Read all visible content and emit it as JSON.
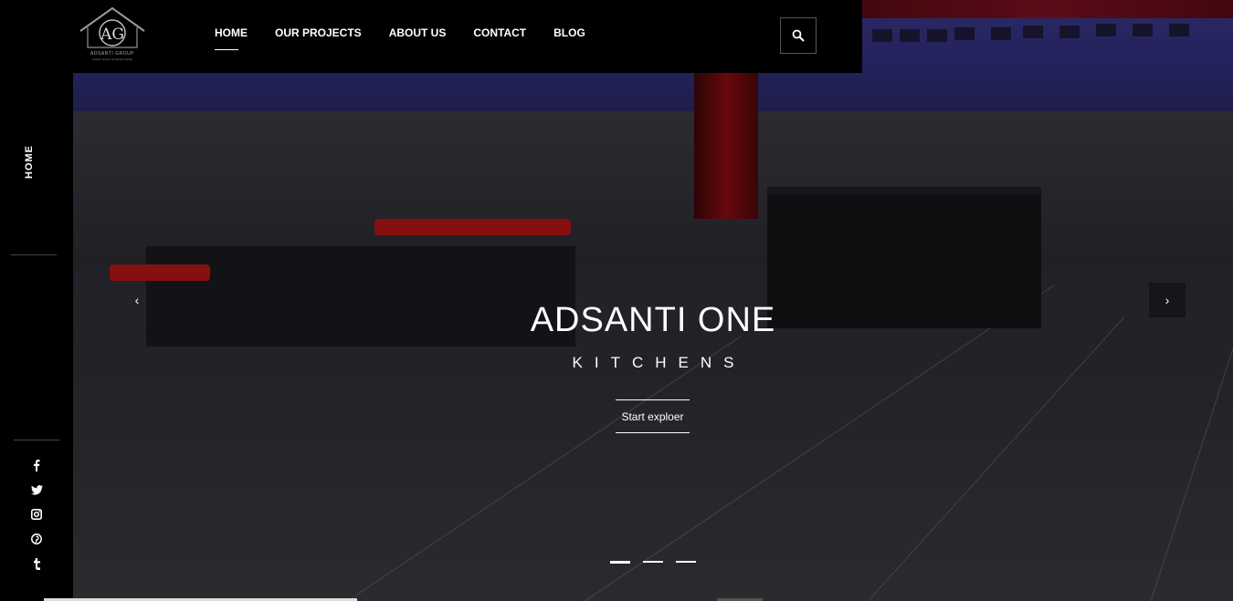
{
  "logo": {
    "monogram": "AG",
    "name": "ADSANTI GROUP",
    "tagline": "Custom Homes & Interiors Studio"
  },
  "nav": {
    "items": [
      {
        "label": "HOME",
        "active": true
      },
      {
        "label": "OUR PROJECTS",
        "active": false
      },
      {
        "label": "ABOUT US",
        "active": false
      },
      {
        "label": "CONTACT",
        "active": false
      },
      {
        "label": "BLOG",
        "active": false
      }
    ],
    "search_icon": "search-icon"
  },
  "sidebar": {
    "vertical_label": "HOME",
    "social": [
      {
        "icon": "facebook-icon",
        "glyph": "f"
      },
      {
        "icon": "twitter-icon",
        "glyph": "t"
      },
      {
        "icon": "instagram-icon",
        "glyph": "ig"
      },
      {
        "icon": "pinterest-icon",
        "glyph": "p"
      },
      {
        "icon": "tumblr-icon",
        "glyph": "t"
      }
    ]
  },
  "hero": {
    "title": "ADSANTI ONE",
    "subtitle": "KITCHENS",
    "cta_label": "Start exploer",
    "prev_arrow": "‹",
    "next_arrow": "›",
    "slides_total": 3,
    "slide_active": 1
  },
  "colors": {
    "background": "#000000",
    "accent_red": "#b31414",
    "text": "#ffffff"
  }
}
